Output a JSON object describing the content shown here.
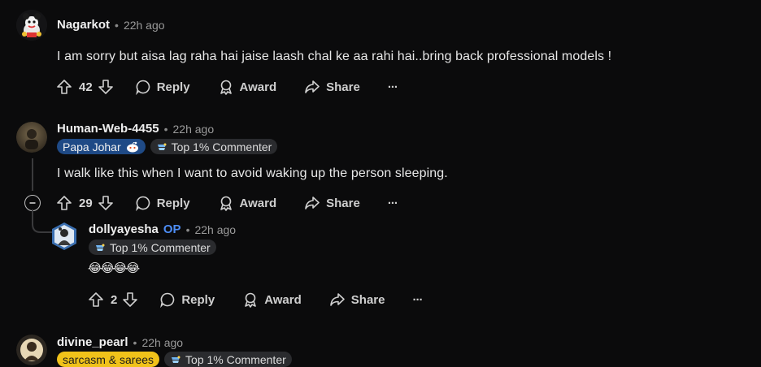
{
  "comments": [
    {
      "username": "Nagarkot",
      "time": "22h ago",
      "text": "I am sorry but aisa lag raha hai jaise laash chal ke aa rahi hai..bring back professional models !",
      "votes": "42",
      "actions": {
        "reply": "Reply",
        "award": "Award",
        "share": "Share",
        "more": "···"
      }
    },
    {
      "username": "Human-Web-4455",
      "time": "22h ago",
      "flair": "Papa Johar",
      "badge": "Top 1% Commenter",
      "text": "I walk like this when I want to avoid waking up the person sleeping.",
      "votes": "29",
      "actions": {
        "reply": "Reply",
        "award": "Award",
        "share": "Share",
        "more": "···"
      },
      "reply": {
        "username": "dollyayesha",
        "op_label": "OP",
        "time": "22h ago",
        "badge": "Top 1% Commenter",
        "text": "😂😂😂😂",
        "votes": "2",
        "actions": {
          "reply": "Reply",
          "award": "Award",
          "share": "Share",
          "more": "···"
        }
      }
    },
    {
      "username": "divine_pearl",
      "time": "22h ago",
      "flair": "sarcasm & sarees",
      "badge": "Top 1% Commenter"
    }
  ],
  "separator": "•",
  "colors": {
    "background": "#0b0b0c",
    "op": "#4d8df5",
    "flair_blue": "#1f4a86",
    "flair_yellow": "#f0c21a"
  }
}
